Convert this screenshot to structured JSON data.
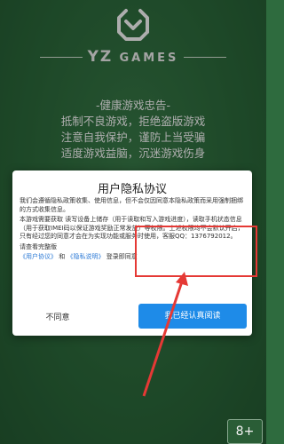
{
  "brand": {
    "name_left": "YZ",
    "name_right": "GAMES"
  },
  "health_notice": {
    "title": "-健康游戏忠告-",
    "lines": [
      "抵制不良游戏，拒绝盗版游戏",
      "注意自我保护，谨防上当受骗",
      "适度游戏益脑，沉迷游戏伤身"
    ]
  },
  "dialog": {
    "title": "用户隐私协议",
    "para1": "我们会遵循隐私政策收集、使用信息，但不会仅因同意本隐私政策而采用强制捆绑的方式收集信息。",
    "para2": "本游戏需要获取 读写设备上储存（用于读取和写入游戏进度），读取手机状态信息（用于获取IMEI码以保证游戏奖励正常发放）等权限。上述权限均不会默认开启，只有经过您的同意才会在为实现功能或服务时使用，客服QQ：1376792012。",
    "read_full": "请查看完整版",
    "agreement_link": "《用户协议》",
    "and_text": "和",
    "privacy_link": "《隐私说明》",
    "agree_suffix": "登录即同意",
    "cancel_label": "不同意",
    "ok_label": "我已经认真阅读"
  },
  "corner_button": {
    "label": "8+"
  },
  "colors": {
    "accent": "#1e8be8",
    "background": "#2e6b3e",
    "highlight": "#e53935"
  }
}
